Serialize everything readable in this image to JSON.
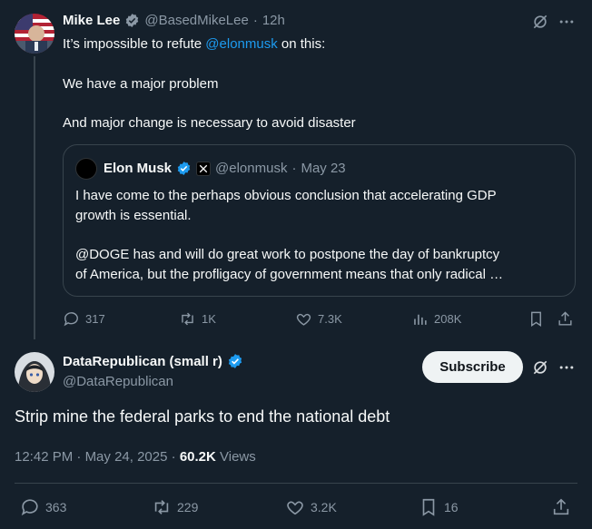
{
  "colors": {
    "background": "#15202b",
    "accent": "#1d9bf0",
    "muted": "#8b98a5",
    "border": "#38444d",
    "text": "#f7f9f9"
  },
  "parent_tweet": {
    "name": "Mike Lee",
    "handle": "@BasedMikeLee",
    "sep": "·",
    "time": "12h",
    "text_prefix": "It’s impossible to refute ",
    "mention": "@elonmusk",
    "text_suffix": " on this:",
    "line2": "We have a major problem",
    "line3": "And major change is necessary to avoid disaster",
    "icons": {
      "grok": "grok-icon",
      "more": "more-icon",
      "verified": "verified-badge-icon"
    },
    "quote": {
      "name": "Elon Musk",
      "handle": "@elonmusk",
      "sep": "·",
      "date": "May 23",
      "line1": "I have come to the perhaps obvious conclusion that accelerating GDP",
      "line2": "growth is essential.",
      "line3": "@DOGE has and will do great work to postpone the day of bankruptcy",
      "line4": "of America, but the profligacy of government means that only radical …",
      "icons": {
        "verified": "verified-badge-icon",
        "affiliate": "x-logo-icon"
      }
    },
    "actions": {
      "replies": "317",
      "reposts": "1K",
      "likes": "7.3K",
      "views": "208K"
    }
  },
  "main_tweet": {
    "name": "DataRepublican (small r)",
    "handle": "@DataRepublican",
    "subscribe_label": "Subscribe",
    "text": "Strip mine the federal parks to end the national debt",
    "time": "12:42 PM",
    "sep1": "·",
    "date": "May 24, 2025",
    "sep2": "·",
    "views_count": "60.2K",
    "views_label": "Views",
    "actions": {
      "replies": "363",
      "reposts": "229",
      "likes": "3.2K",
      "bookmarks": "16"
    }
  }
}
